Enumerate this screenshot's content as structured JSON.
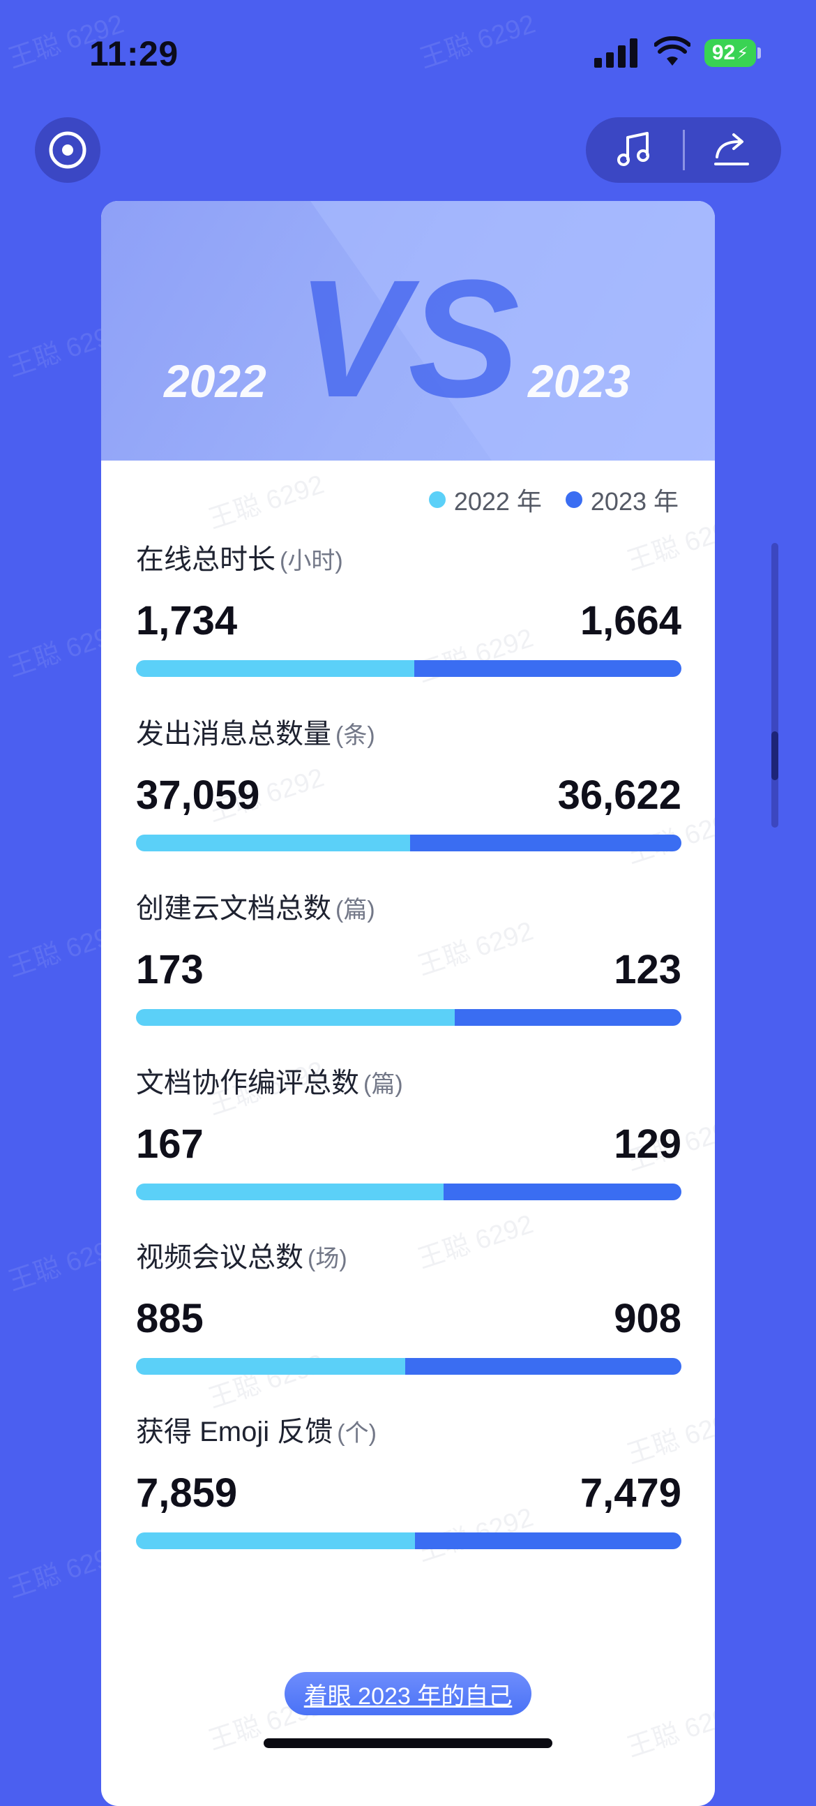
{
  "status_bar": {
    "time": "11:29",
    "battery": "92"
  },
  "header": {
    "vs_text": "VS",
    "year_left": "2022",
    "year_right": "2023"
  },
  "legend": {
    "a_label": "2022 年",
    "b_label": "2023 年",
    "a_color": "#5bd0f8",
    "b_color": "#3a6df2"
  },
  "stats": [
    {
      "title": "在线总时长",
      "unit": "(小时)",
      "v2022": "1,734",
      "v2023": "1,664",
      "ratio2022": 0.51
    },
    {
      "title": "发出消息总数量",
      "unit": "(条)",
      "v2022": "37,059",
      "v2023": "36,622",
      "ratio2022": 0.503
    },
    {
      "title": "创建云文档总数",
      "unit": "(篇)",
      "v2022": "173",
      "v2023": "123",
      "ratio2022": 0.584
    },
    {
      "title": "文档协作编评总数",
      "unit": "(篇)",
      "v2022": "167",
      "v2023": "129",
      "ratio2022": 0.564
    },
    {
      "title": "视频会议总数",
      "unit": "(场)",
      "v2022": "885",
      "v2023": "908",
      "ratio2022": 0.494
    },
    {
      "title": "获得 Emoji 反馈",
      "unit": "(个)",
      "v2022": "7,859",
      "v2023": "7,479",
      "ratio2022": 0.512
    }
  ],
  "cta": {
    "label": "着眼 2023 年的自己"
  },
  "watermark": "王聪 6292",
  "icons": {
    "left_button": "target-icon",
    "music": "music-note-icon",
    "share": "share-icon"
  }
}
